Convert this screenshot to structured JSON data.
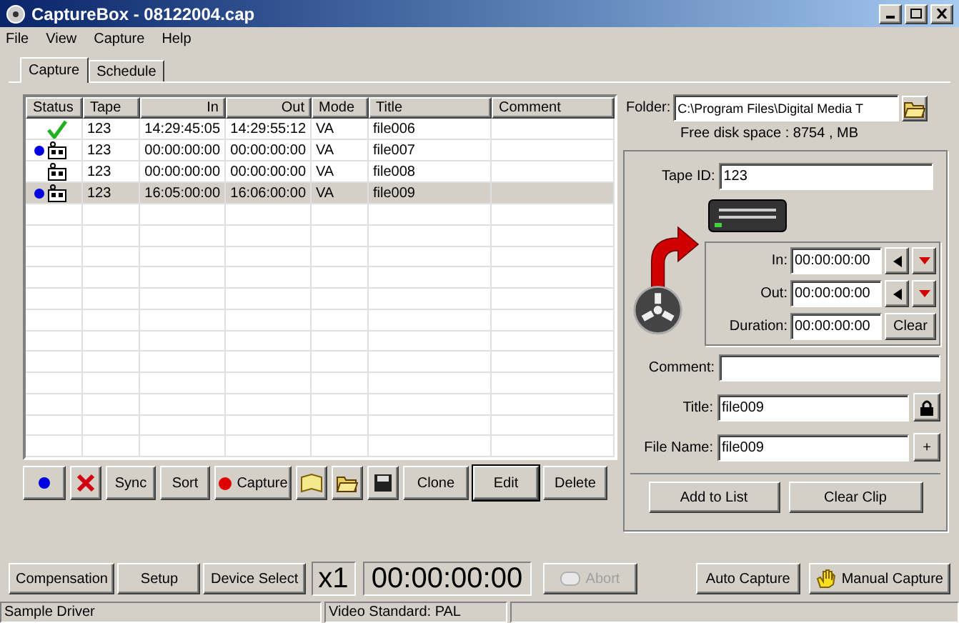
{
  "window": {
    "title": "CaptureBox - 08122004.cap"
  },
  "menu": [
    "File",
    "View",
    "Capture",
    "Help"
  ],
  "tabs": [
    {
      "label": "Capture",
      "selected": true
    },
    {
      "label": "Schedule",
      "selected": false
    }
  ],
  "table": {
    "columns": [
      {
        "label": "Status"
      },
      {
        "label": "Tape"
      },
      {
        "label": "In"
      },
      {
        "label": "Out"
      },
      {
        "label": "Mode"
      },
      {
        "label": "Title"
      },
      {
        "label": "Comment"
      }
    ],
    "rows": [
      {
        "kind": "check",
        "marked": false,
        "selected": false,
        "cells": [
          "",
          "123",
          "14:29:45:05",
          "14:29:55:12",
          "VA",
          "file006",
          ""
        ]
      },
      {
        "kind": "tape",
        "marked": true,
        "selected": false,
        "cells": [
          "",
          "123",
          "00:00:00:00",
          "00:00:00:00",
          "VA",
          "file007",
          ""
        ]
      },
      {
        "kind": "tape",
        "marked": false,
        "selected": false,
        "cells": [
          "",
          "123",
          "00:00:00:00",
          "00:00:00:00",
          "VA",
          "file008",
          ""
        ]
      },
      {
        "kind": "tape",
        "marked": true,
        "selected": true,
        "cells": [
          "",
          "123",
          "16:05:00:00",
          "16:06:00:00",
          "VA",
          "file009",
          ""
        ]
      }
    ]
  },
  "toolbar": [
    {
      "kind": "dot"
    },
    {
      "kind": "cross"
    },
    {
      "kind": "text",
      "label": "Sync",
      "default": false
    },
    {
      "kind": "text",
      "label": "Sort",
      "default": false
    },
    {
      "kind": "record",
      "label": "Capture"
    },
    {
      "kind": "book"
    },
    {
      "kind": "open"
    },
    {
      "kind": "save"
    },
    {
      "kind": "text",
      "label": "Clone",
      "default": false
    },
    {
      "kind": "text",
      "label": "Edit",
      "default": true
    },
    {
      "kind": "text",
      "label": "Delete",
      "default": false
    }
  ],
  "bottom_bar": {
    "buttons": [
      {
        "label": "Compensation"
      },
      {
        "label": "Setup"
      },
      {
        "label": "Device Select"
      }
    ],
    "speed": "x1",
    "timecode": "00:00:00:00",
    "abort": {
      "label": "Abort",
      "disabled": true
    }
  },
  "right_panel": {
    "folder_label": "Folder:",
    "folder": "C:\\Program Files\\Digital Media T",
    "free_space": "Free disk space : 8754 , MB",
    "tape_id_label": "Tape ID:",
    "tape_id": "123",
    "in_label": "In:",
    "in": "00:00:00:00",
    "out_label": "Out:",
    "out": "00:00:00:00",
    "duration_label": "Duration:",
    "duration": "00:00:00:00",
    "clear": "Clear",
    "comment_label": "Comment:",
    "title_label": "Title:",
    "title": "file009",
    "file_name_label": "File Name:",
    "file_name": "file009",
    "plus": "+",
    "add_to_list": "Add to List",
    "clear_clip": "Clear Clip",
    "auto_capture": "Auto Capture",
    "manual_capture": "Manual Capture"
  },
  "status_bar": [
    "Sample Driver",
    "Video Standard: PAL"
  ]
}
